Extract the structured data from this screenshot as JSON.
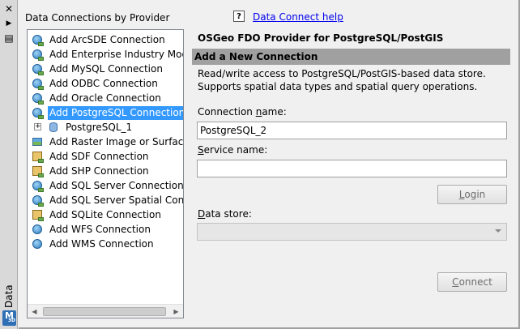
{
  "strip": {
    "title": "Data Connect",
    "close_glyph": "✕",
    "pin_glyph": "▶",
    "menu_glyph": "▤",
    "logo_text": "M",
    "logo_sub": "3D"
  },
  "panel": {
    "title": "Data Connections by Provider"
  },
  "tree": {
    "items": [
      {
        "label": "Add ArcSDE Connection",
        "icon": "database-icon"
      },
      {
        "label": "Add Enterprise Industry Model C",
        "icon": "database-icon"
      },
      {
        "label": "Add MySQL Connection",
        "icon": "database-icon"
      },
      {
        "label": "Add ODBC Connection",
        "icon": "database-icon"
      },
      {
        "label": "Add Oracle Connection",
        "icon": "database-icon"
      },
      {
        "label": "Add PostgreSQL Connection",
        "icon": "database-icon",
        "selected": true
      },
      {
        "label": "PostgreSQL_1",
        "icon": "cylinder-icon",
        "child": true
      },
      {
        "label": "Add Raster Image or Surface Co",
        "icon": "raster-icon"
      },
      {
        "label": "Add SDF Connection",
        "icon": "file-icon"
      },
      {
        "label": "Add SHP Connection",
        "icon": "file-icon"
      },
      {
        "label": "Add SQL Server Connection",
        "icon": "database-icon"
      },
      {
        "label": "Add SQL Server Spatial Connect",
        "icon": "database-icon"
      },
      {
        "label": "Add SQLite Connection",
        "icon": "file-icon"
      },
      {
        "label": "Add WFS Connection",
        "icon": "globe-icon"
      },
      {
        "label": "Add WMS Connection",
        "icon": "globe-icon"
      }
    ],
    "expander_glyph": "+",
    "scroll_left": "◀",
    "scroll_right": "▶"
  },
  "help": {
    "icon_text": "?",
    "link": "Data Connect help"
  },
  "form": {
    "provider_title": "OSGeo FDO Provider for PostgreSQL/PostGIS",
    "section_title": "Add a New Connection",
    "description": "Read/write access to PostgreSQL/PostGIS-based data store. Supports spatial data types and spatial query operations.",
    "connection_name_label": "Connection name:",
    "connection_name_value": "PostgreSQL_2",
    "service_name_label": "Service name:",
    "service_name_value": "",
    "login_button": "Login",
    "data_store_label": "Data store:",
    "data_store_value": "",
    "connect_button": "Connect"
  }
}
